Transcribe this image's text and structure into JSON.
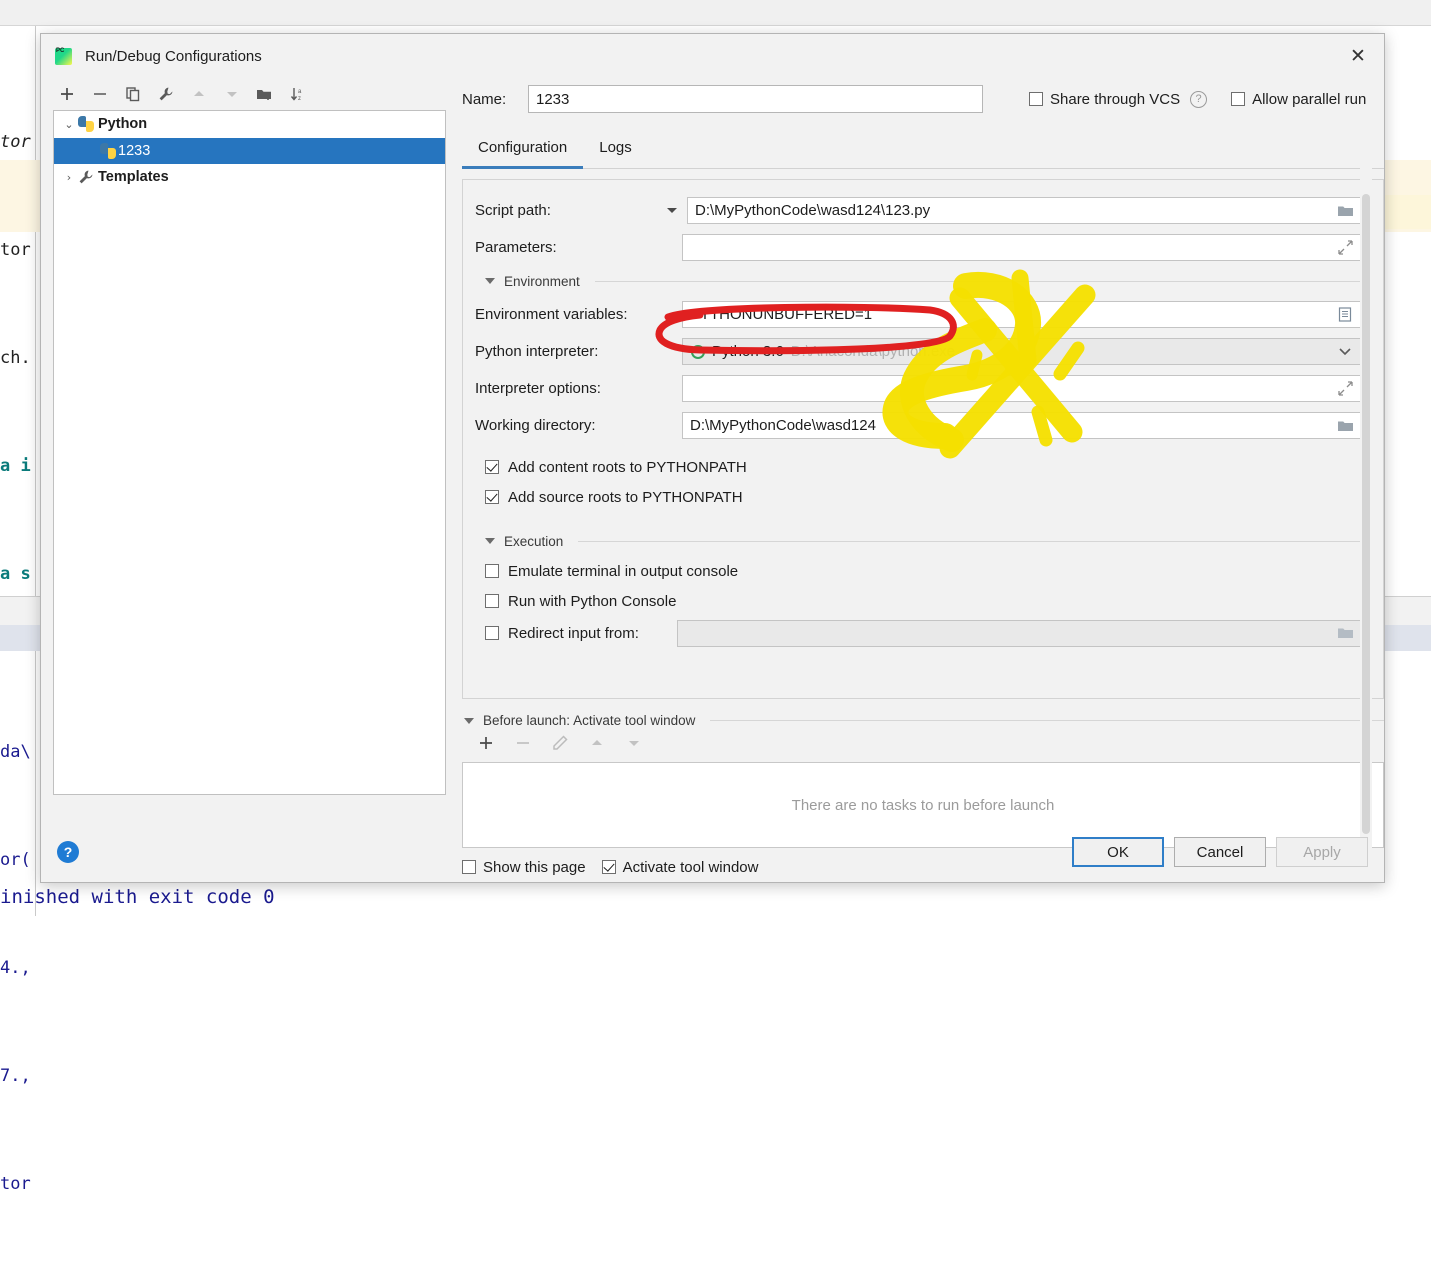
{
  "background": {
    "code_lines": [
      "tor",
      "tor",
      "ch.",
      "a i",
      "a s"
    ],
    "console_lines": [
      "da\\",
      "or(",
      "4.,",
      "7.,",
      "tor"
    ],
    "console_status": "inished with exit code 0"
  },
  "dialog": {
    "title": "Run/Debug Configurations",
    "app_icon": "pycharm-icon",
    "close_label": "✕",
    "toolbar": [
      {
        "name": "add-configuration-button",
        "glyph": "+"
      },
      {
        "name": "remove-configuration-button",
        "glyph": "−"
      },
      {
        "name": "copy-configuration-button",
        "glyph": "copy-icon"
      },
      {
        "name": "edit-templates-button",
        "glyph": "wrench-icon"
      },
      {
        "name": "move-up-button",
        "glyph": "triangle-up-icon"
      },
      {
        "name": "move-down-button",
        "glyph": "triangle-down-icon"
      },
      {
        "name": "new-folder-button",
        "glyph": "folder-add-icon"
      },
      {
        "name": "sort-configurations-button",
        "glyph": "sort-az-icon"
      }
    ],
    "tree": [
      {
        "label": "Python",
        "twisty": "⌄",
        "icon": "python-icon",
        "bold": true,
        "selected": false,
        "indent": 0
      },
      {
        "label": "1233",
        "twisty": "",
        "icon": "python-icon",
        "bold": false,
        "selected": true,
        "indent": 1
      },
      {
        "label": "Templates",
        "twisty": "›",
        "icon": "wrench-icon",
        "bold": true,
        "selected": false,
        "indent": 0
      }
    ],
    "name": {
      "label": "Name:",
      "value": "1233",
      "placeholder": ""
    },
    "share_vcs": {
      "label": "Share through VCS",
      "checked": false
    },
    "share_vcs_help": "?",
    "allow_parallel": {
      "label": "Allow parallel run",
      "checked": false
    },
    "tabs": [
      {
        "label": "Configuration",
        "active": true
      },
      {
        "label": "Logs",
        "active": false
      }
    ],
    "fields": {
      "script_path": {
        "label": "Script path:",
        "value": "D:\\MyPythonCode\\wasd124\\123.py",
        "trailing_icon": "folder-icon",
        "has_combo": true
      },
      "parameters": {
        "label": "Parameters:",
        "value": "",
        "placeholder": "",
        "trailing_icon": "expand-icon"
      },
      "environment_section": "Environment",
      "env_vars": {
        "label": "Environment variables:",
        "value": "PYTHONUNBUFFERED=1",
        "trailing_icon": "list-icon"
      },
      "interpreter": {
        "label": "Python interpreter:",
        "value": "Python 3.6",
        "path_hint": "D:\\Anaconda\\python.exe",
        "trailing_icon": "chevron-down-icon"
      },
      "interpreter_options": {
        "label": "Interpreter options:",
        "value": "",
        "placeholder": "",
        "trailing_icon": "expand-icon"
      },
      "working_dir": {
        "label": "Working directory:",
        "value": "D:\\MyPythonCode\\wasd124",
        "trailing_icon": "folder-icon"
      }
    },
    "path_checks": [
      {
        "label": "Add content roots to PYTHONPATH",
        "checked": true
      },
      {
        "label": "Add source roots to PYTHONPATH",
        "checked": true
      }
    ],
    "execution_section": "Execution",
    "exec_checks": [
      {
        "label": "Emulate terminal in output console",
        "checked": false
      },
      {
        "label": "Run with Python Console",
        "checked": false
      }
    ],
    "redirect_input": {
      "label": "Redirect input from:",
      "checked": false,
      "value": "",
      "trailing_icon": "folder-icon"
    },
    "before_launch": {
      "title": "Before launch: Activate tool window",
      "toolbar": [
        {
          "name": "add-task-button",
          "glyph": "+"
        },
        {
          "name": "remove-task-button",
          "glyph": "−"
        },
        {
          "name": "edit-task-button",
          "glyph": "pencil-icon"
        },
        {
          "name": "move-task-up-button",
          "glyph": "triangle-up-icon"
        },
        {
          "name": "move-task-down-button",
          "glyph": "triangle-down-icon"
        }
      ],
      "empty_text": "There are no tasks to run before launch"
    },
    "bottom_checks": [
      {
        "label": "Show this page",
        "checked": false
      },
      {
        "label": "Activate tool window",
        "checked": true
      }
    ],
    "help_button": "?",
    "buttons": [
      {
        "label": "OK",
        "state": "focused"
      },
      {
        "label": "Cancel",
        "state": "normal"
      },
      {
        "label": "Apply",
        "state": "disabled"
      }
    ]
  },
  "annotations": {
    "red_circle": {
      "color": "#e02020",
      "target": "python-interpreter-field"
    },
    "yellow_highlight": {
      "color": "#f5e000",
      "shape": "star-and-loop"
    }
  }
}
